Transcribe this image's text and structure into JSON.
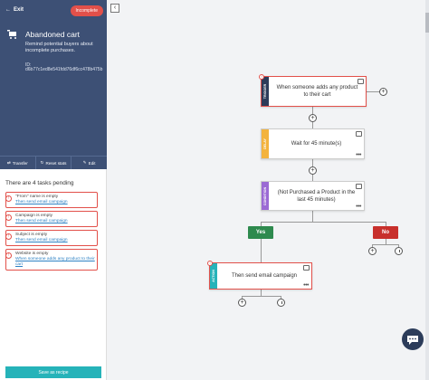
{
  "sidebar": {
    "exit_label": "Exit",
    "status_badge": "Incomplete",
    "title": "Abandoned cart",
    "description": "Remind potential buyers about incomplete purchases.",
    "id_label": "ID:",
    "id_value": "d6b77c1ed8e541fdd76df6cc478b475b",
    "actions": [
      {
        "label": "Transfer"
      },
      {
        "label": "Reset stats"
      },
      {
        "label": "Edit"
      }
    ],
    "tasks_heading": "There are 4 tasks pending",
    "tasks": [
      {
        "issue": "\"From\" name is empty",
        "link": "Then send email campaign"
      },
      {
        "issue": "Campaign is empty",
        "link": "Then send email campaign"
      },
      {
        "issue": "Subject is empty",
        "link": "Then send email campaign"
      },
      {
        "issue": "Website is empty",
        "link": "When someone adds any product to their cart"
      }
    ],
    "save_label": "Save as recipe"
  },
  "flow": {
    "trigger": {
      "tag": "TRIGGER",
      "text": "When someone adds any product to their cart",
      "color": "#2c3c5a"
    },
    "delay": {
      "tag": "DELAY",
      "text": "Wait for 45 minute(s)",
      "color": "#f3b33d"
    },
    "condition": {
      "tag": "CONDITION",
      "text": "(Not Purchased a Product in the last 45 minutes)",
      "color": "#9b6ad4"
    },
    "yes_label": "Yes",
    "no_label": "No",
    "yes_color": "#2e8a4e",
    "no_color": "#c8302c",
    "action": {
      "tag": "ACTION",
      "text": "Then send email campaign",
      "color": "#26b3b9"
    }
  },
  "colors": {
    "sidebar_bg": "#3d5075",
    "error": "#e2504a",
    "save_button": "#26b3b9"
  }
}
